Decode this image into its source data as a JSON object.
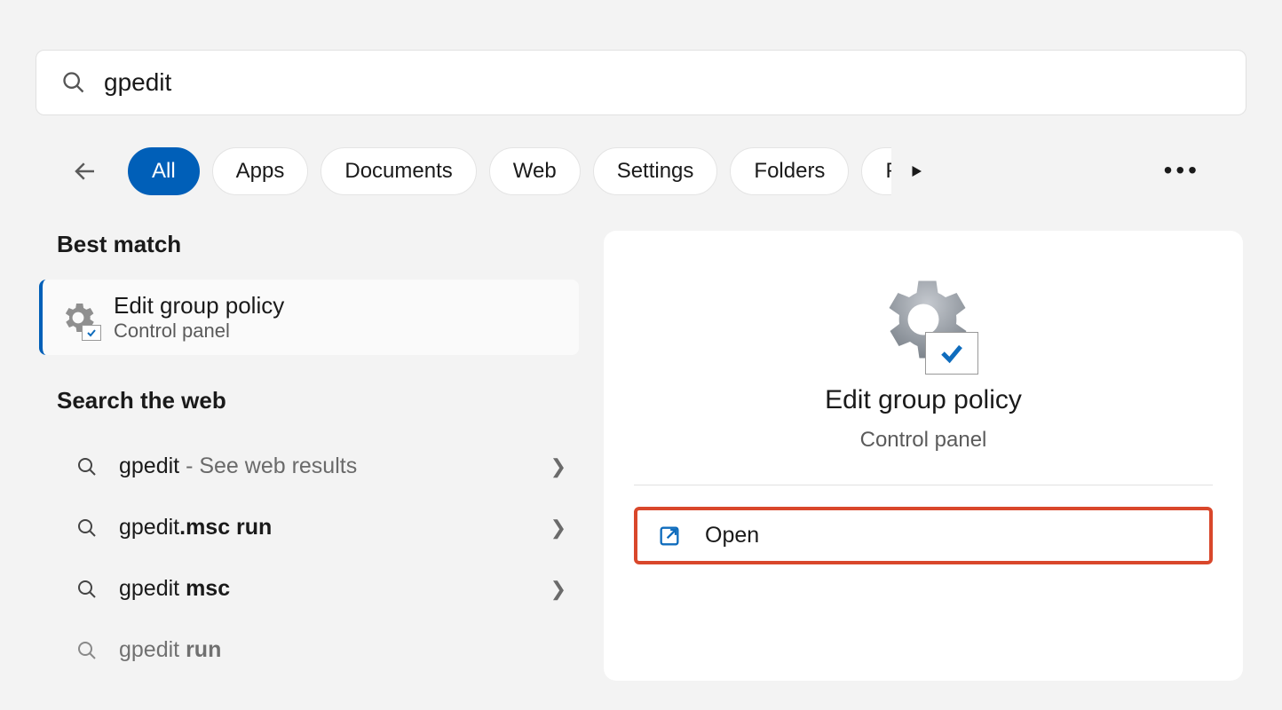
{
  "search": {
    "query": "gpedit"
  },
  "filters": {
    "items": [
      "All",
      "Apps",
      "Documents",
      "Web",
      "Settings",
      "Folders",
      "Photos"
    ],
    "active_index": 0
  },
  "sections": {
    "best_match_label": "Best match",
    "search_web_label": "Search the web"
  },
  "best_match": {
    "title": "Edit group policy",
    "subtitle": "Control panel",
    "icon": "gear-check-icon"
  },
  "web_results": [
    {
      "prefix": "gpedit",
      "suffix": " - See web results"
    },
    {
      "prefix": "gpedit",
      "suffix": ".msc run"
    },
    {
      "prefix": "gpedit ",
      "suffix": "msc"
    },
    {
      "prefix": "gpedit ",
      "suffix": "run"
    }
  ],
  "detail": {
    "title": "Edit group policy",
    "subtitle": "Control panel",
    "open_label": "Open"
  }
}
